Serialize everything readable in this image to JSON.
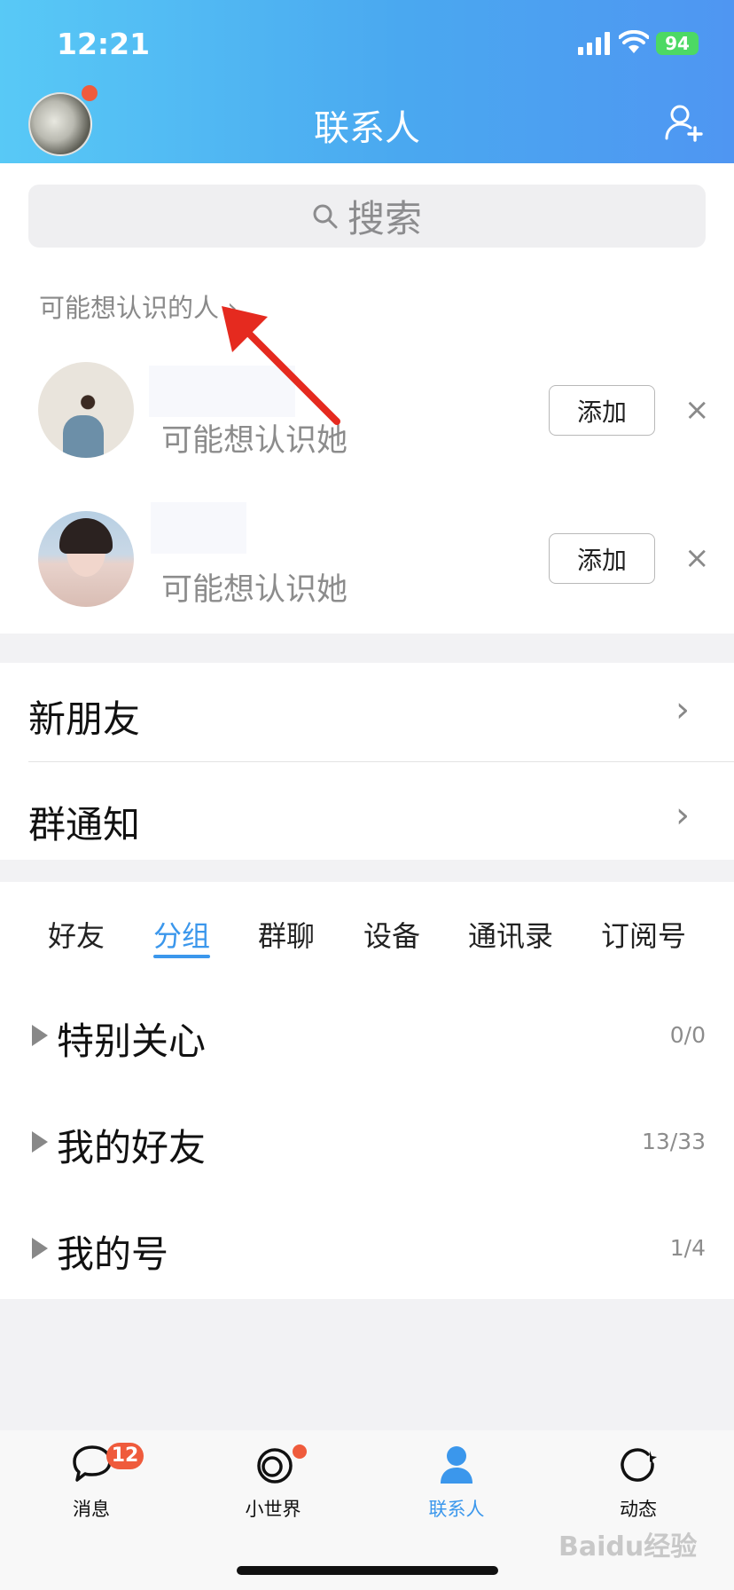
{
  "status_bar": {
    "time": "12:21",
    "battery": "94"
  },
  "header": {
    "title": "联系人"
  },
  "search": {
    "placeholder": "搜索"
  },
  "suggestions": {
    "title": "可能想认识的人 ›",
    "items": [
      {
        "subtitle": "可能想认识她",
        "add_label": "添加",
        "dismiss": "×"
      },
      {
        "subtitle": "可能想认识她",
        "add_label": "添加",
        "dismiss": "×"
      }
    ]
  },
  "menu": {
    "new_friends": "新朋友",
    "group_notice": "群通知",
    "chevron": "›"
  },
  "tabs": [
    "好友",
    "分组",
    "群聊",
    "设备",
    "通讯录",
    "订阅号"
  ],
  "active_tab": "分组",
  "groups": [
    {
      "name": "特别关心",
      "count": "0/0"
    },
    {
      "name": "我的好友",
      "count": "13/33"
    },
    {
      "name": "我的号",
      "count": "1/4"
    }
  ],
  "tabbar": {
    "items": [
      "消息",
      "小世界",
      "联系人",
      "动态"
    ],
    "active": "联系人",
    "message_badge": "12"
  },
  "watermark": "Baidu经验",
  "colors": {
    "accent": "#3b97ec",
    "badge": "#ef5b3c",
    "header_start": "#58c9f6",
    "header_end": "#4f96f2"
  }
}
